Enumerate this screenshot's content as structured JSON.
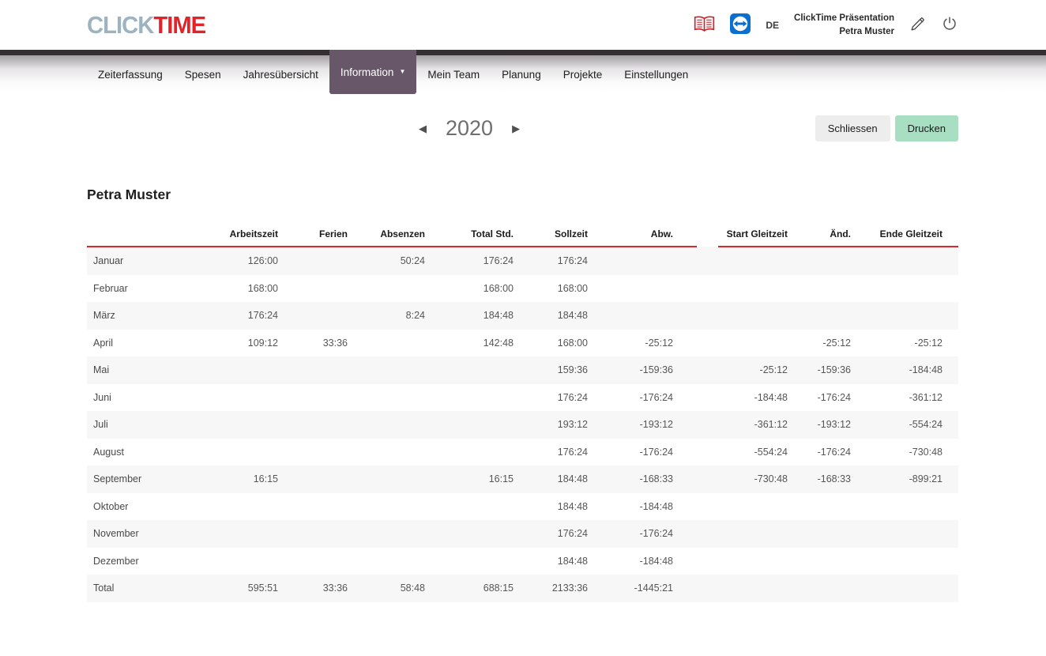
{
  "header": {
    "logo": {
      "part1": "CLICK",
      "part2": "TIME"
    },
    "language": "DE",
    "account": {
      "line1": "ClickTime Präsentation",
      "line2": "Petra Muster"
    },
    "icons": {
      "manual": "open-book-icon",
      "remote_support": "teamviewer-icon",
      "edit": "pencil-icon",
      "logout": "power-icon"
    }
  },
  "nav": {
    "dropdown_caret": "▼",
    "items": [
      {
        "label": "Zeiterfassung",
        "active": false,
        "has_dropdown": false
      },
      {
        "label": "Spesen",
        "active": false,
        "has_dropdown": false
      },
      {
        "label": "Jahresübersicht",
        "active": false,
        "has_dropdown": false
      },
      {
        "label": "Information",
        "active": true,
        "has_dropdown": true
      },
      {
        "label": "Mein Team",
        "active": false,
        "has_dropdown": false
      },
      {
        "label": "Planung",
        "active": false,
        "has_dropdown": false
      },
      {
        "label": "Projekte",
        "active": false,
        "has_dropdown": false
      },
      {
        "label": "Einstellungen",
        "active": false,
        "has_dropdown": false
      }
    ]
  },
  "toolbar": {
    "year": "2020",
    "prev_icon": "◀",
    "next_icon": "▶",
    "close_label": "Schliessen",
    "print_label": "Drucken"
  },
  "page": {
    "employee_name": "Petra Muster"
  },
  "table": {
    "columns": [
      "Arbeitszeit",
      "Ferien",
      "Absenzen",
      "Total Std.",
      "Sollzeit",
      "Abw.",
      "Start Gleitzeit",
      "Änd.",
      "Ende Gleitzeit"
    ],
    "rows": [
      {
        "label": "Januar",
        "values": [
          "126:00",
          "",
          "50:24",
          "176:24",
          "176:24",
          "",
          "",
          "",
          ""
        ]
      },
      {
        "label": "Februar",
        "values": [
          "168:00",
          "",
          "",
          "168:00",
          "168:00",
          "",
          "",
          "",
          ""
        ]
      },
      {
        "label": "März",
        "values": [
          "176:24",
          "",
          "8:24",
          "184:48",
          "184:48",
          "",
          "",
          "",
          ""
        ]
      },
      {
        "label": "April",
        "values": [
          "109:12",
          "33:36",
          "",
          "142:48",
          "168:00",
          "-25:12",
          "",
          "-25:12",
          "-25:12"
        ]
      },
      {
        "label": "Mai",
        "values": [
          "",
          "",
          "",
          "",
          "159:36",
          "-159:36",
          "-25:12",
          "-159:36",
          "-184:48"
        ]
      },
      {
        "label": "Juni",
        "values": [
          "",
          "",
          "",
          "",
          "176:24",
          "-176:24",
          "-184:48",
          "-176:24",
          "-361:12"
        ]
      },
      {
        "label": "Juli",
        "values": [
          "",
          "",
          "",
          "",
          "193:12",
          "-193:12",
          "-361:12",
          "-193:12",
          "-554:24"
        ]
      },
      {
        "label": "August",
        "values": [
          "",
          "",
          "",
          "",
          "176:24",
          "-176:24",
          "-554:24",
          "-176:24",
          "-730:48"
        ]
      },
      {
        "label": "September",
        "values": [
          "16:15",
          "",
          "",
          "16:15",
          "184:48",
          "-168:33",
          "-730:48",
          "-168:33",
          "-899:21"
        ]
      },
      {
        "label": "Oktober",
        "values": [
          "",
          "",
          "",
          "",
          "184:48",
          "-184:48",
          "",
          "",
          ""
        ]
      },
      {
        "label": "November",
        "values": [
          "",
          "",
          "",
          "",
          "176:24",
          "-176:24",
          "",
          "",
          ""
        ]
      },
      {
        "label": "Dezember",
        "values": [
          "",
          "",
          "",
          "",
          "184:48",
          "-184:48",
          "",
          "",
          ""
        ]
      },
      {
        "label": "Total",
        "values": [
          "595:51",
          "33:36",
          "58:48",
          "688:15",
          "2133:36",
          "-1445:21",
          "",
          "",
          ""
        ]
      }
    ]
  }
}
